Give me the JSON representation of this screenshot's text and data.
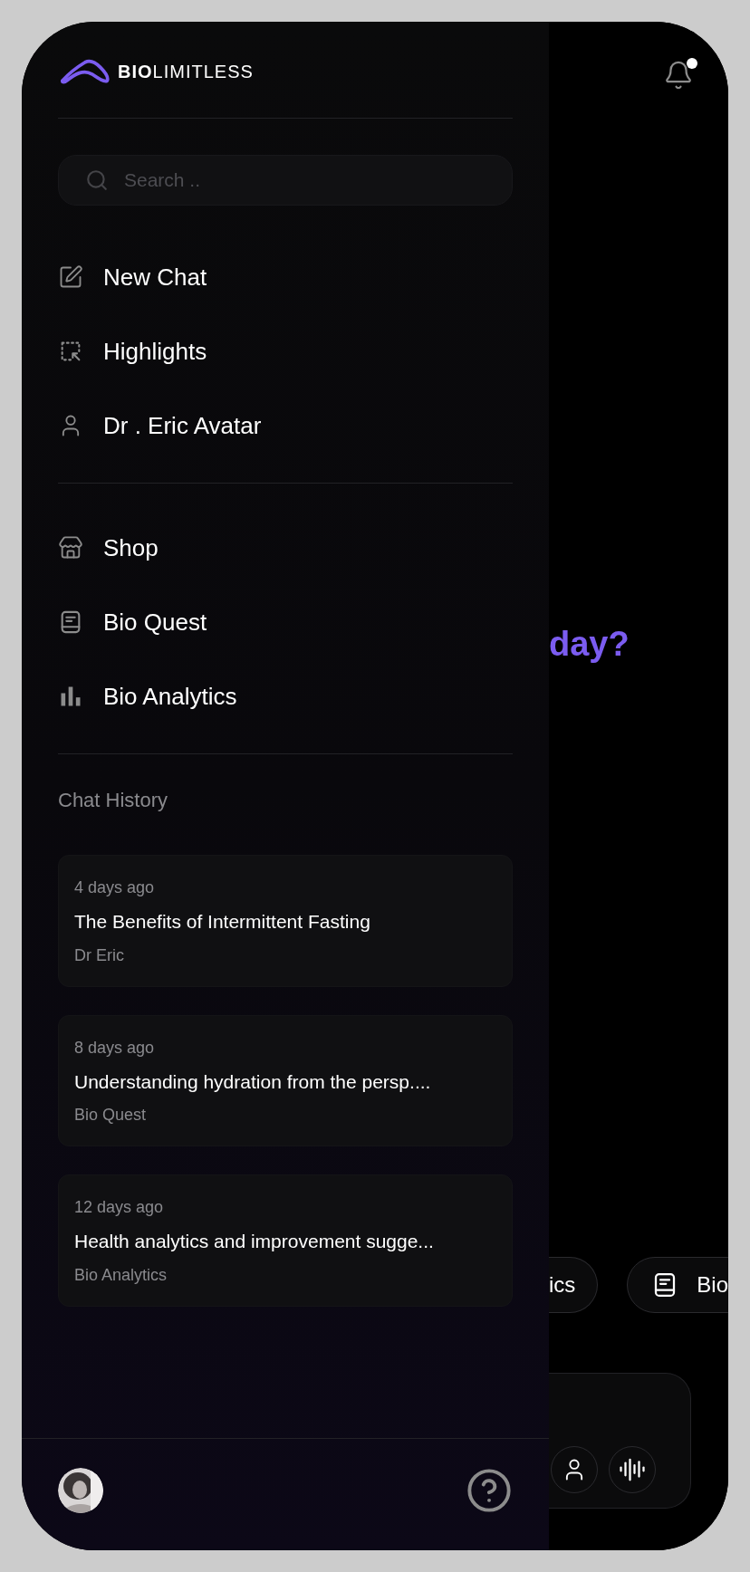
{
  "logo": {
    "bold": "BIO",
    "light": "LIMITLESS"
  },
  "notifications": {
    "unread": true
  },
  "search": {
    "placeholder": "Search .."
  },
  "menu_groups": [
    [
      {
        "kind": "new-chat",
        "label": "New Chat"
      },
      {
        "kind": "highlights",
        "label": "Highlights"
      },
      {
        "kind": "avatar",
        "label": "Dr . Eric Avatar"
      }
    ],
    [
      {
        "kind": "shop",
        "label": "Shop"
      },
      {
        "kind": "quest",
        "label": "Bio Quest"
      },
      {
        "kind": "analytics",
        "label": "Bio Analytics"
      }
    ]
  ],
  "chat_history": {
    "title": "Chat History",
    "items": [
      {
        "date": "4 days ago",
        "title": "The Benefits of Intermittent Fasting",
        "source": "Dr Eric"
      },
      {
        "date": "8 days ago",
        "title": "Understanding hydration from the persp....",
        "source": "Bio Quest"
      },
      {
        "date": "12 days ago",
        "title": "Health analytics and improvement sugge...",
        "source": "Bio Analytics"
      }
    ]
  },
  "main": {
    "heading": "day?",
    "chips": [
      {
        "kind": "plain",
        "label": "ics"
      },
      {
        "kind": "quest",
        "label": "Bio"
      }
    ]
  }
}
